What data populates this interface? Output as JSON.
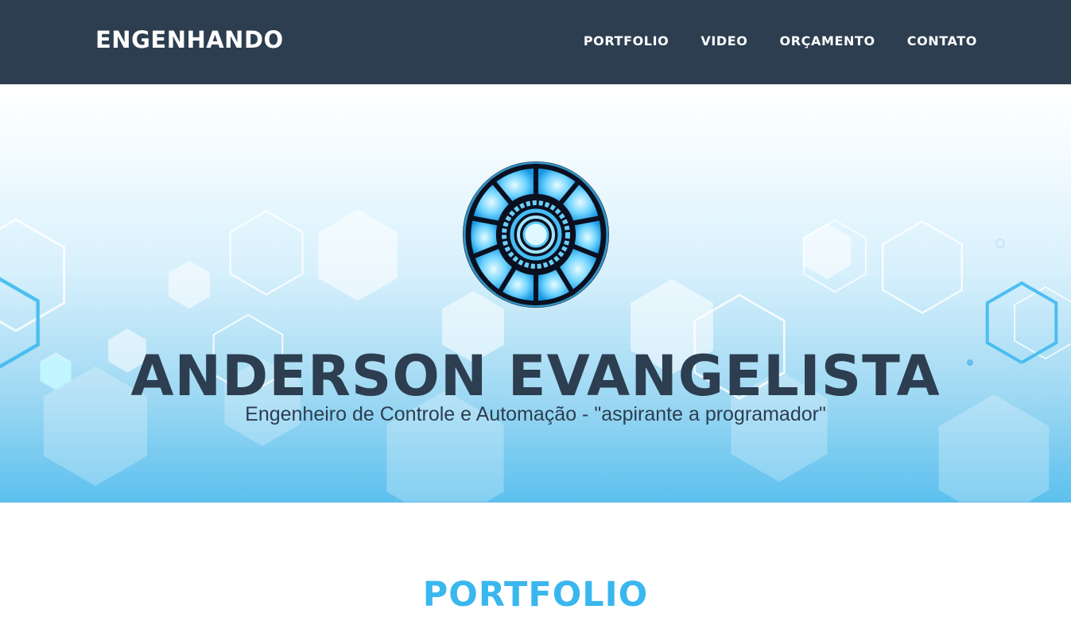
{
  "nav": {
    "brand": "ENGENHANDO",
    "links": [
      "PORTFOLIO",
      "VIDEO",
      "ORÇAMENTO",
      "CONTATO"
    ]
  },
  "hero": {
    "title": "ANDERSON EVANGELISTA",
    "subtitle": "Engenheiro de Controle e Automação - \"aspirante a programador\""
  },
  "portfolio": {
    "title": "PORTFOLIO"
  },
  "colors": {
    "navbar": "#2c3e50",
    "title_text": "#2c3e50",
    "accent": "#39b7ee"
  },
  "icons": {
    "avatar": "arc-reactor-icon"
  }
}
